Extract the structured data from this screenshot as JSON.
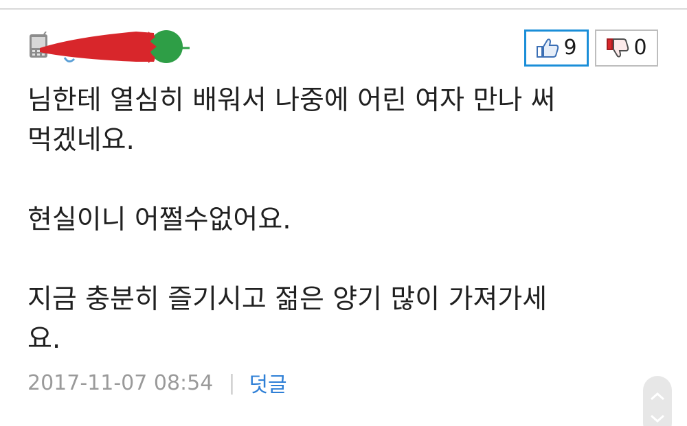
{
  "comment": {
    "author": {
      "device_icon": "mobile-device-icon",
      "name_redacted": true
    },
    "votes": {
      "up_icon": "thumbs-up-icon",
      "up_count": "9",
      "down_icon": "thumbs-down-icon",
      "down_count": "0",
      "accent_color": "#1a8ed8"
    },
    "body_lines": [
      "님한테 열심히 배워서 나중에 어린 여자 만나 써",
      "먹겠네요.",
      "",
      "현실이니 어쩔수없어요.",
      "",
      "지금 충분히 즐기시고 젊은 양기 많이 가져가세",
      "요."
    ],
    "date": "2017-11-07 08:54",
    "separator": "|",
    "reply_label": "덧글",
    "reply_color": "#2e7fd6"
  },
  "scroll": {
    "up_icon": "chevron-up-icon",
    "down_icon": "chevron-down-icon"
  }
}
